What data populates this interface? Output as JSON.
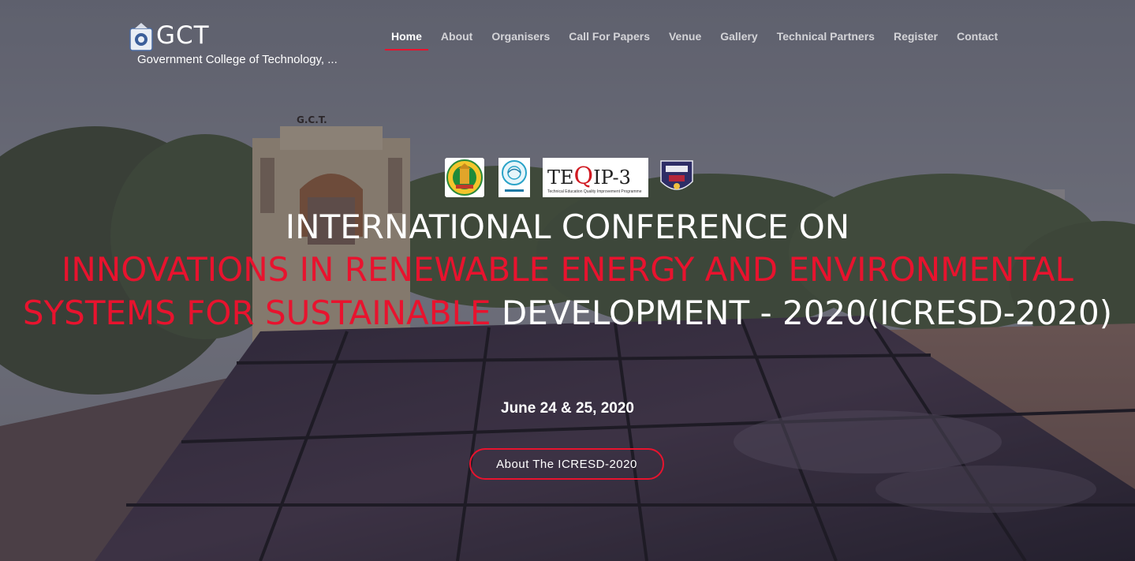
{
  "brand": {
    "name": "GCT",
    "subtitle": "Government College of Technology, ..."
  },
  "nav": {
    "items": [
      {
        "label": "Home",
        "active": true
      },
      {
        "label": "About",
        "active": false
      },
      {
        "label": "Organisers",
        "active": false
      },
      {
        "label": "Call For Papers",
        "active": false
      },
      {
        "label": "Venue",
        "active": false
      },
      {
        "label": "Gallery",
        "active": false
      },
      {
        "label": "Technical Partners",
        "active": false
      },
      {
        "label": "Register",
        "active": false
      },
      {
        "label": "Contact",
        "active": false
      }
    ]
  },
  "logos": {
    "tn_logo": "tamil-nadu-government-emblem",
    "nnie_logo": "nnie-logo",
    "teqip": {
      "prefix": "TE",
      "q": "Q",
      "suffix": "IP-3",
      "tagline": "Technical Education Quality Improvement Programme"
    },
    "crest_logo": "college-crest"
  },
  "hero": {
    "title_line1": "INTERNATIONAL CONFERENCE ON",
    "title_red": "INNOVATIONS IN RENEWABLE ENERGY AND ENVIRONMENTAL SYSTEMS FOR SUSTAINABLE",
    "title_white": " DEVELOPMENT - 2020(ICRESD-2020)",
    "date": "June 24 & 25, 2020",
    "cta_label": "About The ICRESD-2020"
  },
  "colors": {
    "accent": "#e8132e",
    "text": "#ffffff",
    "nav_inactive": "rgba(255,255,255,0.72)"
  },
  "building_sign": "G.C.T."
}
